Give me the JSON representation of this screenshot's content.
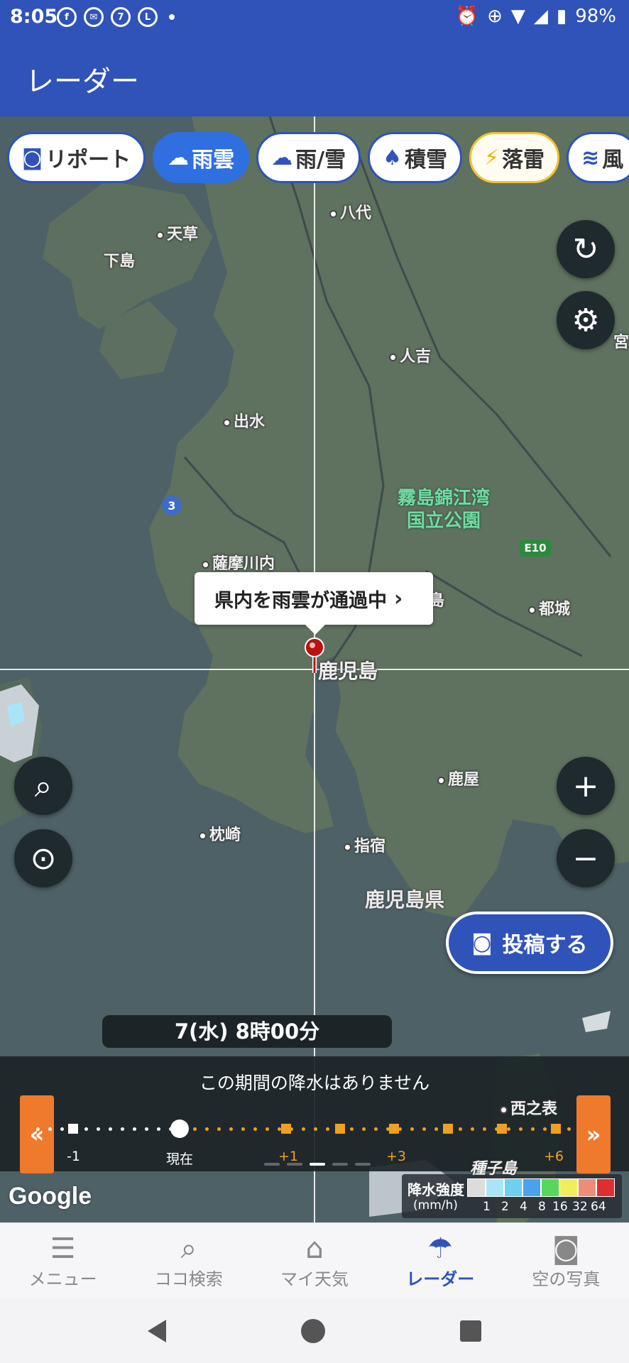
{
  "status_bar": {
    "time": "8:05",
    "battery": "98%",
    "notification_icons": [
      "facebook-icon",
      "messenger-icon",
      "7-eleven-icon",
      "line-icon"
    ],
    "system_icons": [
      "alarm-icon",
      "data-saver-icon",
      "wifi-icon",
      "signal-icon",
      "battery-icon"
    ]
  },
  "app_bar": {
    "title": "レーダー"
  },
  "chips": [
    {
      "label": "リポート",
      "icon": "camera-icon"
    },
    {
      "label": "雨雲",
      "icon": "rain-cloud-icon",
      "active": true
    },
    {
      "label": "雨/雪",
      "icon": "rain-snow-icon"
    },
    {
      "label": "積雪",
      "icon": "snow-depth-icon"
    },
    {
      "label": "落雷",
      "icon": "lightning-icon"
    },
    {
      "label": "風",
      "icon": "wind-icon"
    }
  ],
  "map": {
    "places": [
      "天草",
      "下島",
      "八代",
      "人吉",
      "出水",
      "薩摩川内",
      "都城",
      "鹿児島",
      "鹿屋",
      "枕崎",
      "指宿",
      "西之表",
      "種子島",
      "宮",
      "島"
    ],
    "park": "霧島錦江湾\n国立公園",
    "park_line1": "霧島錦江湾",
    "park_line2": "国立公園",
    "prefecture": "鹿児島県",
    "route_badge": "3",
    "expressway_badge": "E10"
  },
  "callout": {
    "text": "県内を雨雲が通過中"
  },
  "post_button": {
    "label": "投稿する"
  },
  "time_label": "7(水) 8時00分",
  "timeline": {
    "message": "この期間の降水はありません",
    "labels": [
      "-1",
      "現在",
      "+1",
      "+3",
      "+6"
    ]
  },
  "google_logo": "Google",
  "legend": {
    "title": "降水強度",
    "unit": "(mm/h)",
    "values": [
      "1",
      "2",
      "4",
      "8",
      "16",
      "32",
      "64"
    ],
    "colors": [
      "#dcdcdc",
      "#a8e6f7",
      "#6cd0f0",
      "#4aa3ea",
      "#58d85a",
      "#f1ee5c",
      "#ee8c7a",
      "#e02d2d"
    ]
  },
  "bottom_nav": [
    {
      "label": "メニュー",
      "icon": "menu-icon"
    },
    {
      "label": "ココ検索",
      "icon": "search-icon"
    },
    {
      "label": "マイ天気",
      "icon": "home-icon"
    },
    {
      "label": "レーダー",
      "icon": "radar-umbrella-icon",
      "active": true
    },
    {
      "label": "空の写真",
      "icon": "camera-icon"
    }
  ]
}
